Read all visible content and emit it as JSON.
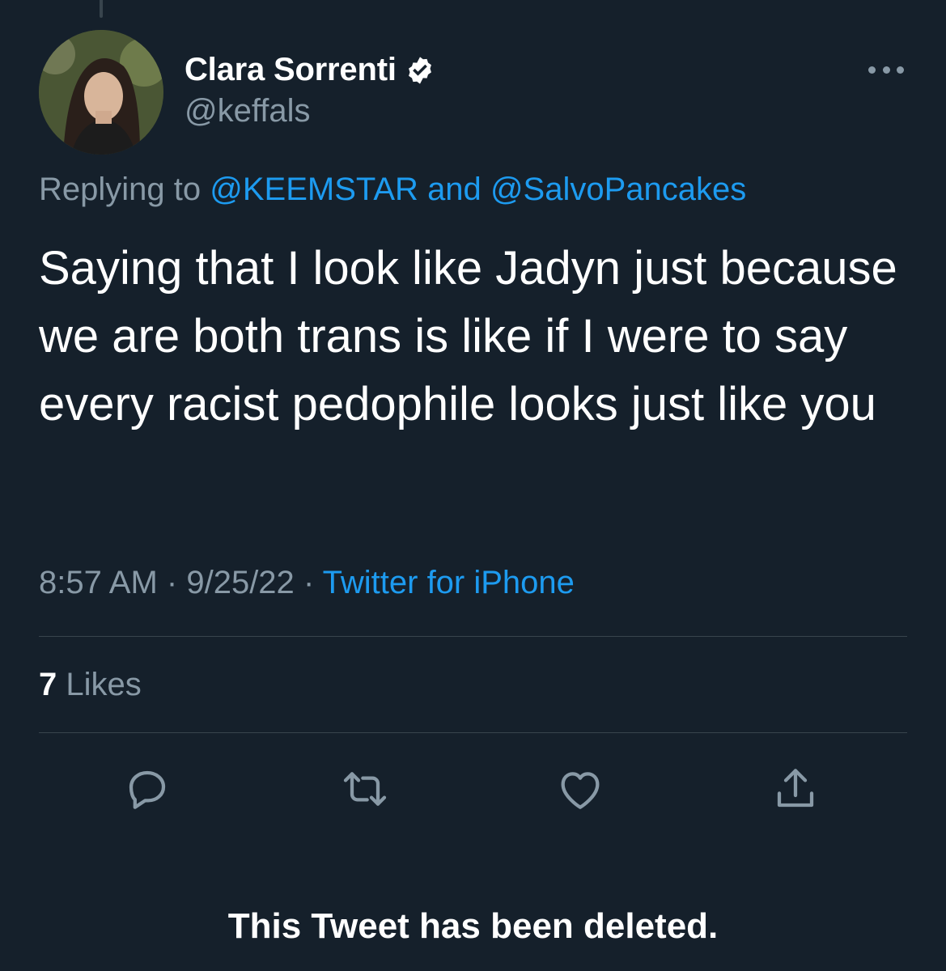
{
  "tweet": {
    "author": {
      "display_name": "Clara Sorrenti",
      "handle": "@keffals",
      "verified_icon": "verified-badge-icon"
    },
    "reply": {
      "prefix": "Replying to",
      "mention_1": "@KEEMSTAR",
      "conjunction": "and",
      "mention_2": "@SalvoPancakes"
    },
    "text": "Saying that I look like Jadyn just because we are both trans is like if I were to say every racist pedophile looks just like you",
    "time": "8:57 AM",
    "date": "9/25/22",
    "separator": "·",
    "source": "Twitter for iPhone",
    "likes_count": "7",
    "likes_label": "Likes"
  },
  "actions": [
    {
      "name": "reply",
      "icon": "reply-icon"
    },
    {
      "name": "retweet",
      "icon": "retweet-icon"
    },
    {
      "name": "like",
      "icon": "heart-icon"
    },
    {
      "name": "share",
      "icon": "share-icon"
    }
  ],
  "notice": "This Tweet has been deleted.",
  "colors": {
    "background": "#15202b",
    "accent": "#1d9bf0",
    "secondary_text": "#8899a6",
    "divider": "#38444d"
  }
}
